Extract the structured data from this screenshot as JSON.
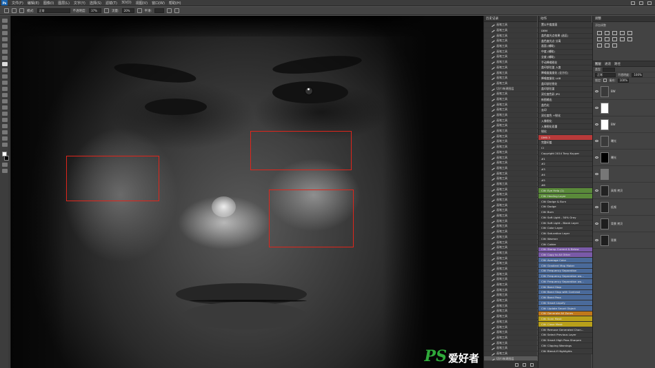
{
  "menubar": {
    "logo": "Ps",
    "items": [
      "文件(F)",
      "编辑(E)",
      "图像(I)",
      "图层(L)",
      "文字(Y)",
      "选择(S)",
      "滤镜(T)",
      "3D(D)",
      "视图(V)",
      "窗口(W)",
      "帮助(H)"
    ]
  },
  "options": {
    "mode_label": "模式:",
    "mode_value": "正常",
    "opacity_label": "不透明度:",
    "opacity_value": "37%",
    "flow_label": "流量:",
    "flow_value": "20%",
    "smooth_label": "平滑:"
  },
  "history": {
    "title": "历史记录",
    "items": [
      "画笔工具",
      "画笔工具",
      "画笔工具",
      "画笔工具",
      "画笔工具",
      "画笔工具",
      "画笔工具",
      "画笔工具",
      "画笔工具",
      "画笔工具",
      "画笔工具",
      "画笔工具",
      "切片/新建图层",
      "画笔工具",
      "画笔工具",
      "画笔工具",
      "画笔工具",
      "画笔工具",
      "画笔工具",
      "画笔工具",
      "画笔工具",
      "画笔工具",
      "画笔工具",
      "画笔工具",
      "画笔工具",
      "画笔工具",
      "画笔工具",
      "画笔工具",
      "画笔工具",
      "画笔工具",
      "画笔工具",
      "画笔工具",
      "画笔工具",
      "画笔工具",
      "画笔工具",
      "画笔工具",
      "画笔工具",
      "画笔工具",
      "画笔工具",
      "画笔工具",
      "画笔工具",
      "画笔工具",
      "画笔工具",
      "画笔工具",
      "画笔工具",
      "画笔工具",
      "画笔工具",
      "画笔工具",
      "画笔工具",
      "画笔工具",
      "画笔工具",
      "画笔工具",
      "画笔工具",
      "画笔工具",
      "画笔工具",
      "画笔工具",
      "画笔工具",
      "画笔工具",
      "画笔工具",
      "画笔工具",
      "画笔工具",
      "画笔工具",
      "画笔工具",
      "切片/新建图层"
    ]
  },
  "actions": {
    "title": "动作",
    "items": [
      {
        "label": "置以中度度面",
        "color": "#3a3a3a"
      },
      {
        "label": "DBM",
        "color": "#3a3a3a"
      },
      {
        "label": "盖色度光点效果 (选区)",
        "color": "#3a3a3a"
      },
      {
        "label": "盖色度光点 分离",
        "color": "#3a3a3a"
      },
      {
        "label": "画面 (辅助)",
        "color": "#3a3a3a"
      },
      {
        "label": "中度 (辅助)",
        "color": "#3a3a3a"
      },
      {
        "label": "全度 (辅助)",
        "color": "#3a3a3a"
      },
      {
        "label": "手动降噪锐化",
        "color": "#3a3a3a"
      },
      {
        "label": "盖印部位盖 入度",
        "color": "#3a3a3a"
      },
      {
        "label": "降噪度度度化 (全方位)",
        "color": "#3a3a3a"
      },
      {
        "label": "降噪度量化 LAB",
        "color": "#3a3a3a"
      },
      {
        "label": "盖印部位锐化",
        "color": "#3a3a3a"
      },
      {
        "label": "盖印部位盖",
        "color": "#3a3a3a"
      },
      {
        "label": "双位度色彩 JPG",
        "color": "#3a3a3a"
      },
      {
        "label": "新图输出",
        "color": "#3a3a3a"
      },
      {
        "label": "盖色化",
        "color": "#3a3a3a"
      },
      {
        "label": "去印",
        "color": "#3a3a3a"
      },
      {
        "label": "双位度色 +锐化",
        "color": "#3a3a3a"
      },
      {
        "label": "入像锐化",
        "color": "#3a3a3a"
      },
      {
        "label": "入像锐化双重",
        "color": "#3a3a3a"
      },
      {
        "label": "锐化",
        "color": "#3a3a3a"
      },
      {
        "label": "DMB 3",
        "color": "#b83a3a"
      },
      {
        "label": "完整印盖",
        "color": "#3a3a3a"
      },
      {
        "label": "CI",
        "color": "#3a3a3a"
      },
      {
        "label": "Copyright 2014 Tony Kuyper",
        "color": "#3a3a3a"
      },
      {
        "label": "#1",
        "color": "#3a3a3a"
      },
      {
        "label": "#2",
        "color": "#3a3a3a"
      },
      {
        "label": "#3",
        "color": "#3a3a3a"
      },
      {
        "label": "#4",
        "color": "#3a3a3a"
      },
      {
        "label": "#5",
        "color": "#3a3a3a"
      },
      {
        "label": "#6",
        "color": "#3a3a3a"
      },
      {
        "label": "CW: Eye Help (1)",
        "color": "#5a8a3a"
      },
      {
        "label": "CW: Healing Layer",
        "color": "#5a8a3a"
      },
      {
        "label": "CW: Dodge & Burn",
        "color": "#3a3a3a"
      },
      {
        "label": "CW: Dodge",
        "color": "#3a3a3a"
      },
      {
        "label": "CW: Burn",
        "color": "#3a3a3a"
      },
      {
        "label": "CW: Soft Light - 50% Gray",
        "color": "#3a3a3a"
      },
      {
        "label": "CW: Soft Light - Blank Layer",
        "color": "#3a3a3a"
      },
      {
        "label": "CW: Color Layer",
        "color": "#3a3a3a"
      },
      {
        "label": "CW: Saturation Layer",
        "color": "#3a3a3a"
      },
      {
        "label": "CW: Warmer",
        "color": "#3a3a3a"
      },
      {
        "label": "CW: Colder",
        "color": "#3a3a3a"
      },
      {
        "label": "CW: Stamp Current & Below",
        "color": "#7a5aa8"
      },
      {
        "label": "CW: Copy to All Other",
        "color": "#7a5aa8"
      },
      {
        "label": "CW: Average Color",
        "color": "#4a6a9a"
      },
      {
        "label": "CW: Gradient Map Maker",
        "color": "#4a6a9a"
      },
      {
        "label": "CW: Frequency Separation",
        "color": "#4a6a9a"
      },
      {
        "label": "CW: Frequency Separation wo...",
        "color": "#4a6a9a"
      },
      {
        "label": "CW: Frequency Separation wo...",
        "color": "#4a6a9a"
      },
      {
        "label": "CW: Band Stop",
        "color": "#4a6a9a"
      },
      {
        "label": "CW: Band Stop with Contrast",
        "color": "#4a6a9a"
      },
      {
        "label": "CW: Band Pass",
        "color": "#4a6a9a"
      },
      {
        "label": "CW: Smart Liquify",
        "color": "#4a6a9a"
      },
      {
        "label": "CW: Update Smart Object",
        "color": "#4a6a9a"
      },
      {
        "label": "CW: Generate All Zones",
        "color": "#c0781a"
      },
      {
        "label": "CW: Scan Mask",
        "color": "#b8a01a"
      },
      {
        "label": "CW: Close Mask",
        "color": "#b8a01a"
      },
      {
        "label": "CW: Remove Generated Chan...",
        "color": "#3a3a3a"
      },
      {
        "label": "CW: Select Previous Layer",
        "color": "#3a3a3a"
      },
      {
        "label": "CW: Smart High Pass Sharpen",
        "color": "#3a3a3a"
      },
      {
        "label": "CW: Clipping Warnings",
        "color": "#3a3a3a"
      },
      {
        "label": "CW: Blend-If Highlights",
        "color": "#3a3a3a"
      }
    ]
  },
  "adjustments": {
    "title": "调整",
    "subtitle": "添加调整"
  },
  "layers": {
    "tabs": [
      "图层",
      "通道",
      "路径"
    ],
    "kind_label": "类型",
    "blend_mode": "正常",
    "opacity_label": "不透明度:",
    "opacity_value": "100%",
    "lock_label": "锁定:",
    "fill_label": "填充:",
    "fill_value": "100%",
    "items": [
      {
        "name": "BW",
        "thumb": "#3a3a3a"
      },
      {
        "name": "",
        "thumb": "#ffffff"
      },
      {
        "name": "BW",
        "thumb": "#ffffff"
      },
      {
        "name": "曝光",
        "thumb": "#3a3a3a"
      },
      {
        "name": "曝光",
        "thumb": "#000000"
      },
      {
        "name": "",
        "thumb": "#777777"
      },
      {
        "name": "高频 拷贝",
        "thumb": "#222222"
      },
      {
        "name": "低频",
        "thumb": "#222222"
      },
      {
        "name": "背景 拷贝",
        "thumb": "#1e1e1e"
      },
      {
        "name": "背景",
        "thumb": "#1e1e1e"
      }
    ]
  },
  "watermark": {
    "brand": "PS",
    "cn": "爱好者",
    "url": "www.psahz.com"
  }
}
